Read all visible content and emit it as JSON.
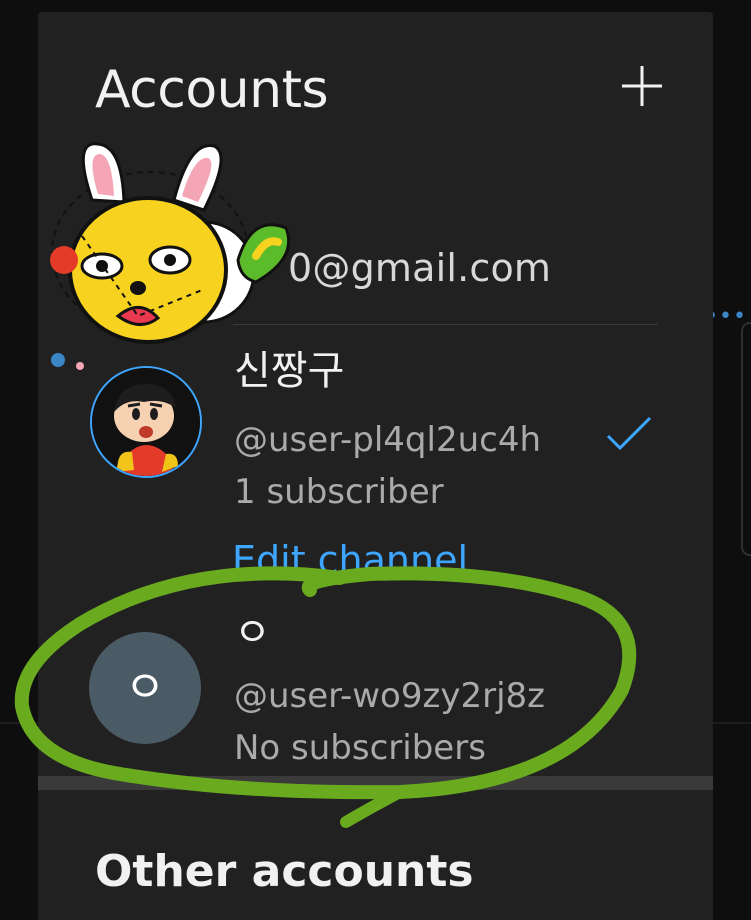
{
  "header": {
    "title": "Accounts",
    "add_icon": "plus-icon"
  },
  "google_account": {
    "email": "0@gmail.com"
  },
  "channels": [
    {
      "name": "신짱구",
      "handle": "@user-pl4ql2uc4h",
      "subscribers": "1 subscriber",
      "selected": true,
      "edit_label": "Edit channel"
    },
    {
      "name": "ㅇ",
      "handle": "@user-wo9zy2rj8z",
      "subscribers": "No subscribers",
      "avatar_letter": "ㅇ",
      "avatar_color": "#4b5b66"
    }
  ],
  "other_section": {
    "title": "Other accounts"
  },
  "colors": {
    "accent": "#3ea6ff",
    "panel": "#212121",
    "annotation": "#6aaa1f"
  }
}
